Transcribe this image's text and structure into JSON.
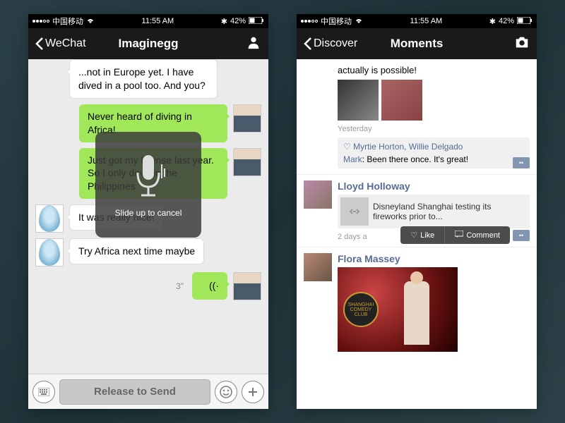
{
  "status": {
    "carrier": "中国移动",
    "time": "11:55 AM",
    "battery": "42%"
  },
  "chat": {
    "back_label": "WeChat",
    "title": "Imaginegg",
    "messages": [
      {
        "side": "left",
        "text": "...not in Europe yet. I have dived in a pool too. And you?"
      },
      {
        "side": "right",
        "text": "Never heard of diving in Africa!"
      },
      {
        "side": "right",
        "text": "Just got my license last year. So I only dove in the Philippines"
      },
      {
        "side": "left",
        "text": "It was really nice!"
      },
      {
        "side": "left",
        "text": "Try Africa next time maybe"
      }
    ],
    "voice_duration": "3\"",
    "overlay_text": "Slide up to cancel",
    "hold_button": "Release to Send"
  },
  "moments": {
    "back_label": "Discover",
    "title": "Moments",
    "post1": {
      "text_fragment": "actually is possible!",
      "time": "Yesterday",
      "likes": "Myrtie Horton, Willie Delgado",
      "comment_name": "Mark",
      "comment_text": ": Been there once. It's great!"
    },
    "post2": {
      "name": "Lloyd Holloway",
      "link_text": "Disneyland Shanghai testing its fireworks prior to...",
      "time": "2 days a",
      "action_like": "Like",
      "action_comment": "Comment"
    },
    "post3": {
      "name": "Flora Massey",
      "badge": "SHANGHAI COMEDY CLUB"
    }
  }
}
